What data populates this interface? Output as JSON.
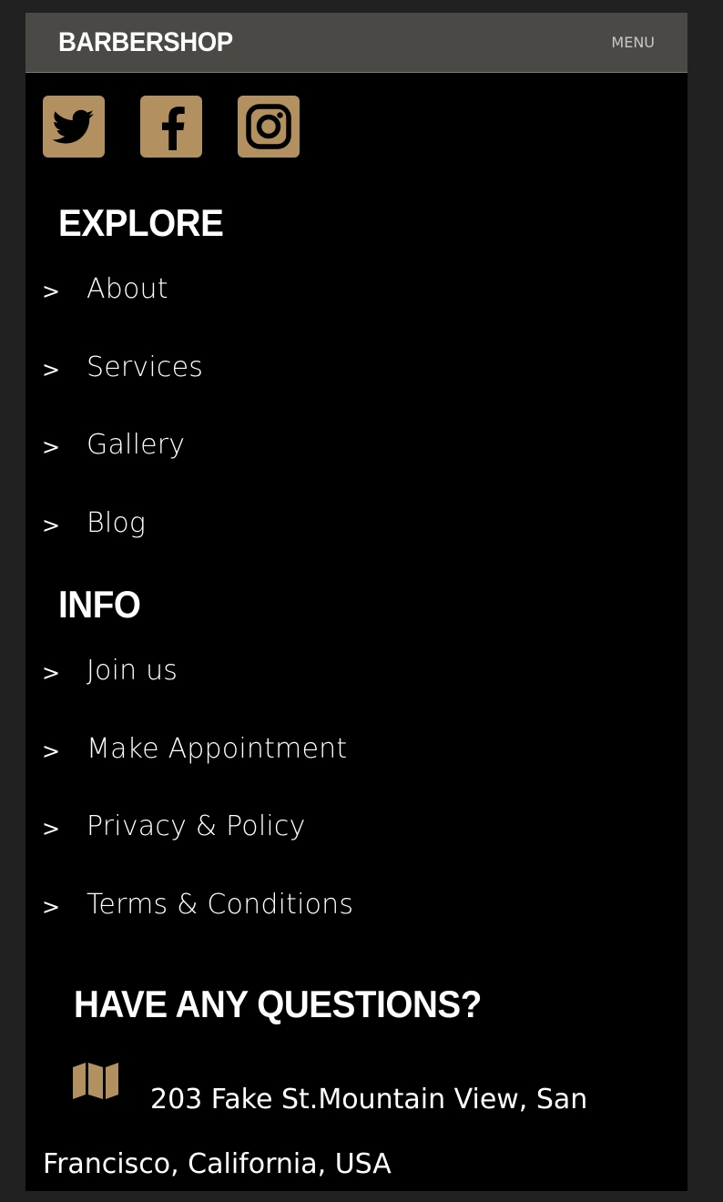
{
  "header": {
    "brand": "BARBERSHOP",
    "menu_label": "MENU"
  },
  "social": [
    {
      "icon": "twitter-icon"
    },
    {
      "icon": "facebook-icon"
    },
    {
      "icon": "instagram-icon"
    }
  ],
  "explore": {
    "title": "EXPLORE",
    "items": [
      {
        "label": "About"
      },
      {
        "label": "Services"
      },
      {
        "label": "Gallery"
      },
      {
        "label": "Blog"
      }
    ]
  },
  "info": {
    "title": "INFO",
    "items": [
      {
        "label": "Join us"
      },
      {
        "label": "Make Appointment"
      },
      {
        "label": "Privacy & Policy"
      },
      {
        "label": "Terms & Conditions"
      }
    ]
  },
  "contact": {
    "title": "HAVE ANY QUESTIONS?",
    "address_icon": "map-icon",
    "address": "203 Fake St.Mountain View, San Francisco, California, USA"
  },
  "colors": {
    "page_background": "#212121",
    "header_background": "#4a4946",
    "accent": "#b3905f",
    "text": "#ffffff"
  }
}
